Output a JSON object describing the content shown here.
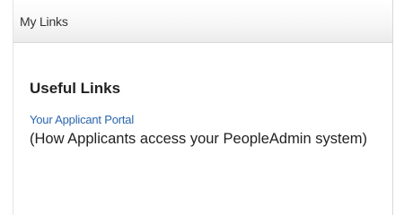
{
  "panel": {
    "title": "My Links",
    "section_heading": "Useful Links",
    "links": [
      {
        "label": "Your Applicant Portal",
        "description": "(How Applicants access your PeopleAdmin system)"
      }
    ]
  },
  "colors": {
    "link": "#2a66ad",
    "text": "#222222",
    "header_bg": "#f2f2f2",
    "border": "#d9d9d9"
  }
}
